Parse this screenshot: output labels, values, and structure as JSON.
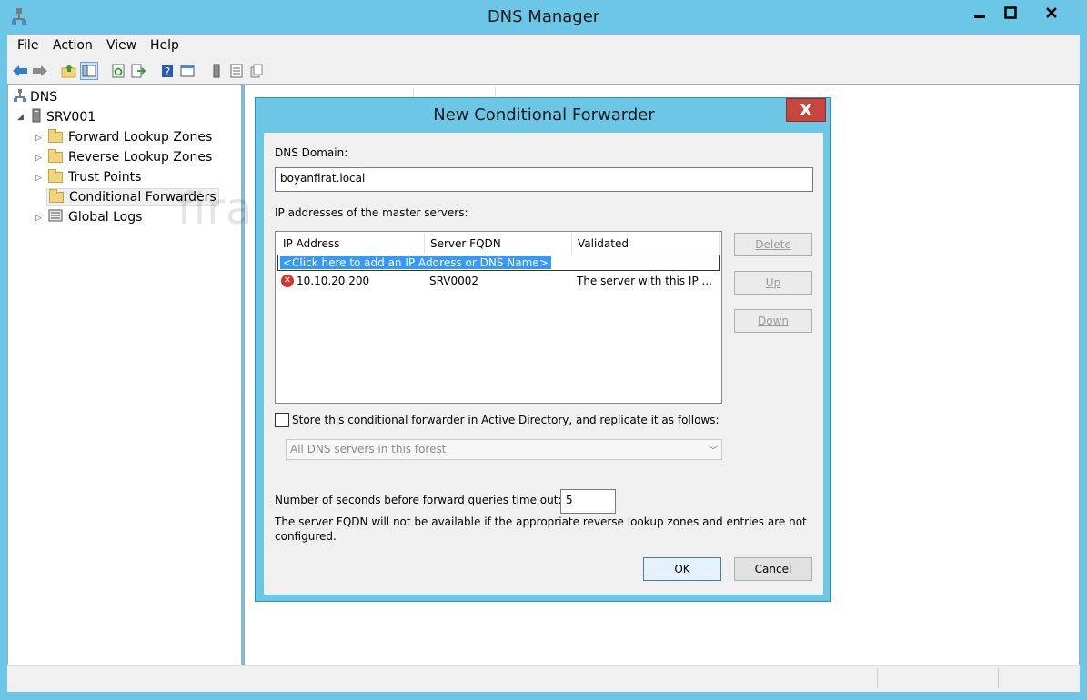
{
  "window": {
    "title": "DNS Manager"
  },
  "menu": {
    "items": [
      "File",
      "Action",
      "View",
      "Help"
    ]
  },
  "toolbar": {
    "icons": [
      "back-icon",
      "forward-icon",
      "up-folder-icon",
      "show-hide-tree-icon",
      "refresh-icon",
      "export-list-icon",
      "help-icon",
      "properties-icon",
      "server-icon",
      "list-icon",
      "copy-icon"
    ]
  },
  "tree": {
    "root": "DNS",
    "server": "SRV001",
    "items": [
      "Forward Lookup Zones",
      "Reverse Lookup Zones",
      "Trust Points",
      "Conditional Forwarders",
      "Global Logs"
    ],
    "selected": "Conditional Forwarders"
  },
  "watermark": "firatboyan.com",
  "dialog": {
    "title": "New Conditional Forwarder",
    "close_label": "X",
    "dns_domain_label": "DNS Domain:",
    "dns_domain_value": "boyanfirat.local",
    "ip_label": "IP addresses of the master servers:",
    "columns": [
      "IP Address",
      "Server FQDN",
      "Validated"
    ],
    "add_row_text": "<Click here to add an IP Address or DNS Name>",
    "rows": [
      {
        "ip": "10.10.20.200",
        "fqdn": "SRV0002",
        "validated": "The server with this IP ..."
      }
    ],
    "side_buttons": {
      "delete": "Delete",
      "up": "Up",
      "down": "Down"
    },
    "store_label": "Store this conditional forwarder in Active Directory, and replicate it as follows:",
    "store_checked": false,
    "replication_value": "All DNS servers in this forest",
    "timeout_label": "Number of seconds before forward queries time out:",
    "timeout_value": "5",
    "note": "The server FQDN will not be available if the appropriate reverse lookup zones and entries are not",
    "note_line2": "configured.",
    "ok_label": "OK",
    "cancel_label": "Cancel"
  },
  "colors": {
    "frame": "#6cc6e6",
    "selection": "#3399ff",
    "dialog_close": "#c7463f"
  }
}
